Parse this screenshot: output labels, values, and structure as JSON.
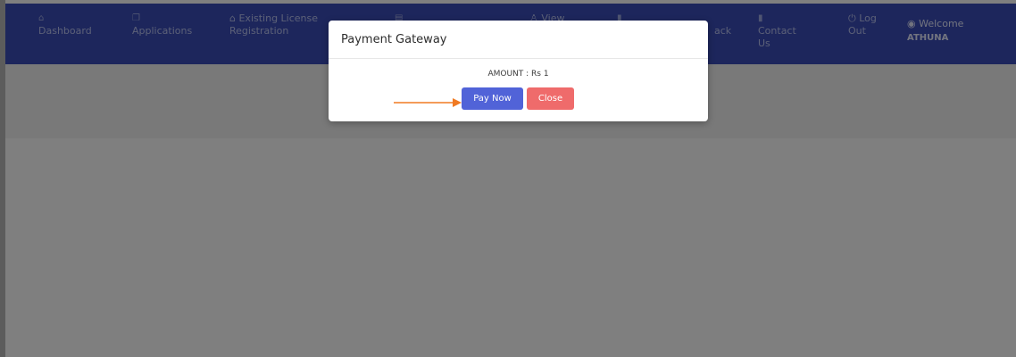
{
  "nav": {
    "items": [
      {
        "label": "Dashboard",
        "label2": "",
        "icon": "home-icon",
        "glyph": "⌂"
      },
      {
        "label": "Applications",
        "label2": "",
        "icon": "copy-icon",
        "glyph": "❐"
      },
      {
        "label": "Existing License",
        "label2": "Registration",
        "icon": "home-icon",
        "glyph": "⌂"
      },
      {
        "label": "",
        "label2": "",
        "icon": "table-icon",
        "glyph": "▤"
      },
      {
        "label": "View",
        "label2": "",
        "icon": "user-icon",
        "glyph": "♙"
      },
      {
        "label": "",
        "label2": "",
        "icon": "file-icon",
        "glyph": "▮"
      },
      {
        "label": "ack",
        "label2": "",
        "icon": "",
        "glyph": ""
      },
      {
        "label": "Contact",
        "label2": "Us",
        "icon": "file-icon",
        "glyph": "▮"
      },
      {
        "label": "Log",
        "label2": "Out",
        "icon": "power-icon",
        "glyph": "⏻"
      }
    ],
    "welcome": {
      "label": "Welcome",
      "glyph": "◉",
      "name": "ATHUNA"
    }
  },
  "modal": {
    "title": "Payment Gateway",
    "amount": "AMOUNT : Rs 1",
    "pay_label": "Pay Now",
    "close_label": "Close"
  },
  "colors": {
    "navbar": "#3b4cb8",
    "pay_button": "#5163d8",
    "close_button": "#ef6b6b",
    "arrow": "#f07a22"
  }
}
